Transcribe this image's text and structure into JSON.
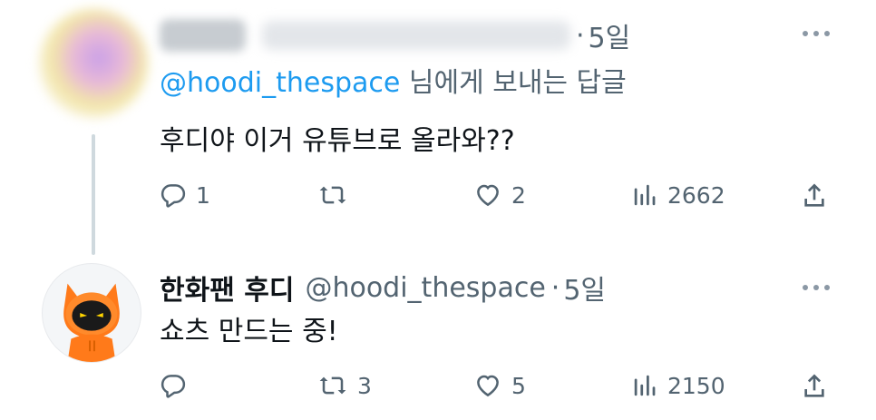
{
  "tweets": [
    {
      "time": "5일",
      "replying_mention": "@hoodi_thespace",
      "replying_suffix": " 님에게 보내는 답글",
      "text": "후디야 이거 유튜브로 올라와??",
      "stats": {
        "replies": "1",
        "retweets": "",
        "likes": "2",
        "views": "2662"
      }
    },
    {
      "name": "한화팬 후디",
      "handle": "@hoodi_thespace",
      "time": "5일",
      "text": "쇼츠 만드는 중!",
      "stats": {
        "replies": "",
        "retweets": "3",
        "likes": "5",
        "views": "2150"
      }
    }
  ],
  "separator": "·",
  "icons": [
    "reply-icon",
    "retweet-icon",
    "like-icon",
    "views-icon",
    "share-icon",
    "more-icon"
  ],
  "colors": {
    "text": "#0f1419",
    "secondary": "#536471",
    "link": "#1d9bf0",
    "thread_line": "#cfd9de",
    "avatar_orange": "#ff7a1a"
  }
}
